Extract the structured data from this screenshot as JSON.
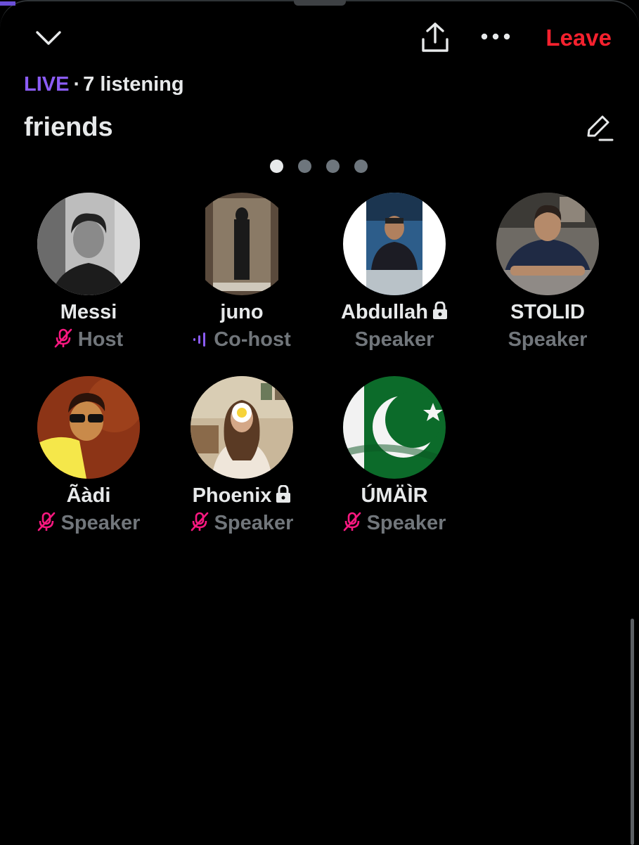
{
  "header": {
    "leave_label": "Leave",
    "icons": [
      "chevron-down-icon",
      "share-icon",
      "more-icon"
    ]
  },
  "status": {
    "live_label": "LIVE",
    "separator": "·",
    "listening": "7 listening"
  },
  "space": {
    "title": "friends"
  },
  "pager": {
    "pages": 4,
    "active_index": 0
  },
  "participants": [
    {
      "name": "Messi",
      "role": "Host",
      "locked": false,
      "mic": "muted"
    },
    {
      "name": "juno",
      "role": "Co-host",
      "locked": false,
      "mic": "speaking"
    },
    {
      "name": "Abdullah",
      "role": "Speaker",
      "locked": true,
      "mic": "none"
    },
    {
      "name": "STOLID",
      "role": "Speaker",
      "locked": false,
      "mic": "none"
    },
    {
      "name": "Ãàdi",
      "role": "Speaker",
      "locked": false,
      "mic": "muted"
    },
    {
      "name": "Phoenix",
      "role": "Speaker",
      "locked": true,
      "mic": "muted"
    },
    {
      "name": "ÚMÄÌR",
      "role": "Speaker",
      "locked": false,
      "mic": "muted"
    }
  ],
  "colors": {
    "accent_live": "#8b5cf6",
    "leave": "#f4212e",
    "muted_mic": "#f91880",
    "role_text": "#71767b",
    "text": "#e7e9ea",
    "background": "#000000"
  }
}
